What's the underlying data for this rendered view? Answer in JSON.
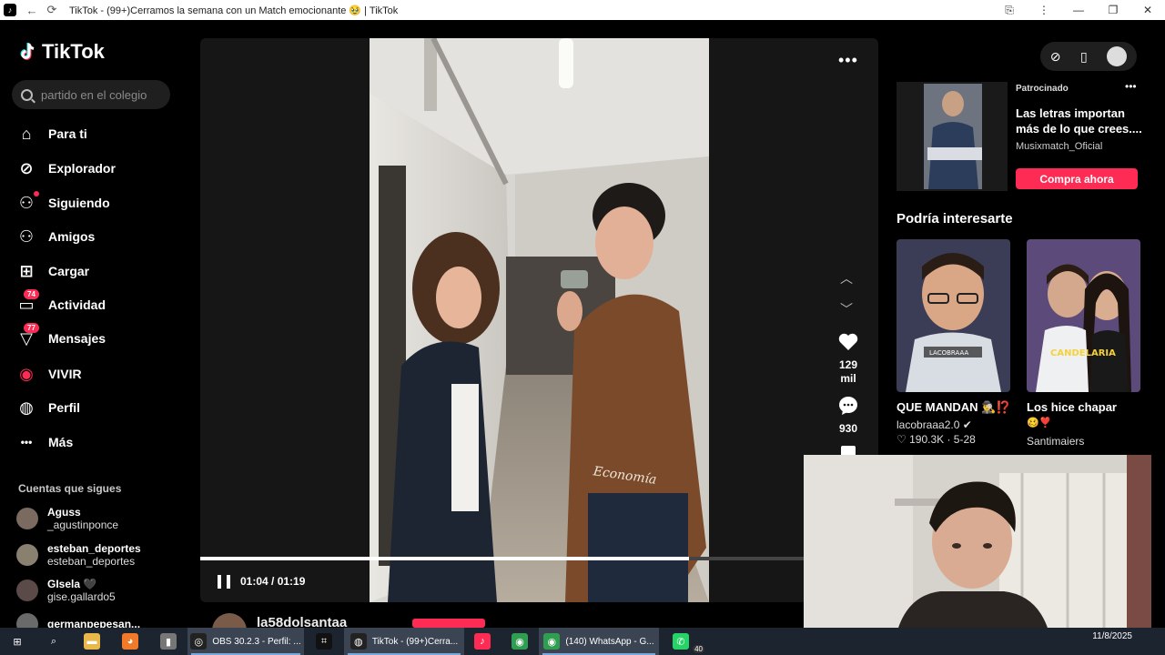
{
  "window": {
    "title": "TikTok - (99+)Cerramos la semana con un Match emocionante 🥹 | TikTok"
  },
  "sidebar": {
    "brand": "TikTok",
    "search_placeholder": "partido en el colegio",
    "nav": [
      {
        "label": "Para ti",
        "icon": "home-icon"
      },
      {
        "label": "Explorador",
        "icon": "compass-icon"
      },
      {
        "label": "Siguiendo",
        "icon": "following-icon"
      },
      {
        "label": "Amigos",
        "icon": "friends-icon"
      },
      {
        "label": "Cargar",
        "icon": "upload-icon"
      },
      {
        "label": "Actividad",
        "icon": "inbox-icon",
        "badge": "74"
      },
      {
        "label": "Mensajes",
        "icon": "send-icon",
        "badge": "77"
      },
      {
        "label": "VIVIR",
        "icon": "live-icon"
      },
      {
        "label": "Perfil",
        "icon": "profile-avatar-icon"
      },
      {
        "label": "Más",
        "icon": "more-icon"
      }
    ],
    "following_title": "Cuentas que sigues",
    "following": [
      {
        "name": "Aguss",
        "handle": "_agustinponce"
      },
      {
        "name": "esteban_deportes",
        "handle": "esteban_deportes"
      },
      {
        "name": "GIsela 🖤",
        "handle": "gise.gallardo5"
      },
      {
        "name": "germanpepesan...",
        "handle": ""
      }
    ]
  },
  "player": {
    "progress": 0.81,
    "time": "01:04 / 01:19",
    "author": "la58dolsantaa",
    "likes": "129\nmil",
    "likes_line1": "129",
    "likes_line2": "mil",
    "comments": "930"
  },
  "right": {
    "tools": [
      "compass-icon",
      "phone-icon",
      "avatar-icon"
    ],
    "ad": {
      "label": "Patrocinado",
      "title": "Las letras importan más de lo que crees....",
      "account": "Musixmatch_Oficial",
      "cta": "Compra ahora"
    },
    "rec_title": "Podría interesarte",
    "recs": [
      {
        "caption": "QUE MANDAN 🕵️‍♂️⁉️",
        "account": "lacobraaa2.0 ✔",
        "stats": "♡ 190.3K · 5-28",
        "overlay": "LACOBRAAA"
      },
      {
        "caption": "Los hice chapar",
        "caption2": "🥴❣️",
        "account": "Santimaiers",
        "stats": "",
        "overlay": "CANDELARIA"
      }
    ]
  },
  "taskbar": {
    "items": [
      {
        "label": "",
        "icon": "windows-start-icon"
      },
      {
        "label": "",
        "icon": "search-icon"
      },
      {
        "label": "",
        "icon": "file-explorer-icon"
      },
      {
        "label": "",
        "icon": "firefox-icon"
      },
      {
        "label": "",
        "icon": "mic-app-icon"
      },
      {
        "label": "OBS 30.2.3 - Perfil: ...",
        "icon": "obs-icon"
      },
      {
        "label": "",
        "icon": "capcut-icon"
      },
      {
        "label": "TikTok - (99+)Cerra...",
        "icon": "chrome-tiktok-icon"
      },
      {
        "label": "",
        "icon": "tiktok-app-icon"
      },
      {
        "label": "",
        "icon": "chrome-icon"
      },
      {
        "label": "(140) WhatsApp - G...",
        "icon": "chrome-whatsapp-icon"
      },
      {
        "label": "",
        "icon": "whatsapp-icon",
        "count": "40"
      }
    ],
    "date": "11/8/2025"
  }
}
